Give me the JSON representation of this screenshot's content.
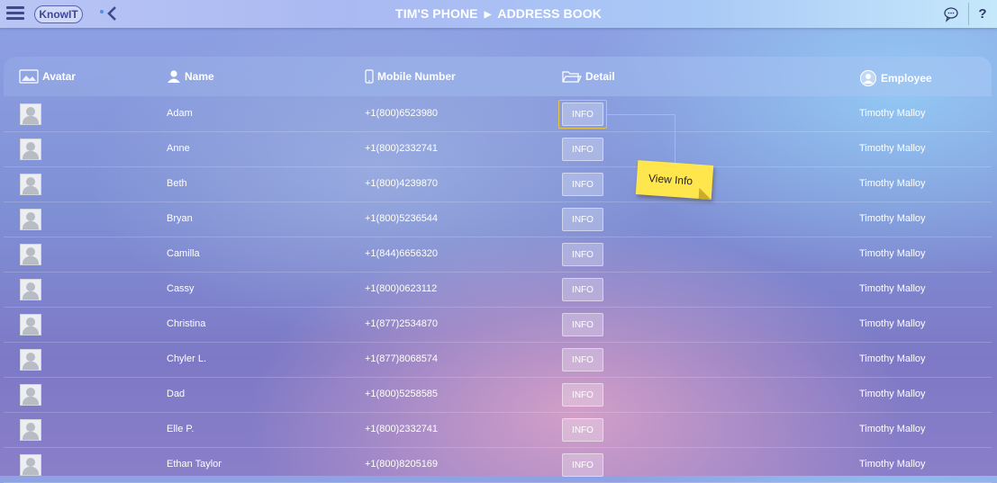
{
  "app": {
    "logo_text": "KnowIT",
    "breadcrumb": [
      "TIM'S PHONE",
      "ADDRESS BOOK"
    ],
    "breadcrumb_separator": "▶"
  },
  "columns": {
    "avatar": "Avatar",
    "name": "Name",
    "mobile": "Mobile Number",
    "detail": "Detail",
    "employee": "Employee"
  },
  "info_label": "INFO",
  "callout": {
    "text": "View Info",
    "color": "#ffe64d"
  },
  "contacts": [
    {
      "name": "Adam",
      "mobile": "+1(800)6523980",
      "employee": "Timothy Malloy"
    },
    {
      "name": "Anne",
      "mobile": "+1(800)2332741",
      "employee": "Timothy Malloy"
    },
    {
      "name": "Beth",
      "mobile": "+1(800)4239870",
      "employee": "Timothy Malloy"
    },
    {
      "name": "Bryan",
      "mobile": "+1(800)5236544",
      "employee": "Timothy Malloy"
    },
    {
      "name": "Camilla",
      "mobile": "+1(844)6656320",
      "employee": "Timothy Malloy"
    },
    {
      "name": "Cassy",
      "mobile": "+1(800)0623112",
      "employee": "Timothy Malloy"
    },
    {
      "name": "Christina",
      "mobile": "+1(877)2534870",
      "employee": "Timothy Malloy"
    },
    {
      "name": "Chyler L.",
      "mobile": "+1(877)8068574",
      "employee": "Timothy Malloy"
    },
    {
      "name": "Dad",
      "mobile": "+1(800)5258585",
      "employee": "Timothy Malloy"
    },
    {
      "name": "Elle P.",
      "mobile": "+1(800)2332741",
      "employee": "Timothy Malloy"
    },
    {
      "name": "Ethan Taylor",
      "mobile": "+1(800)8205169",
      "employee": "Timothy Malloy"
    }
  ]
}
